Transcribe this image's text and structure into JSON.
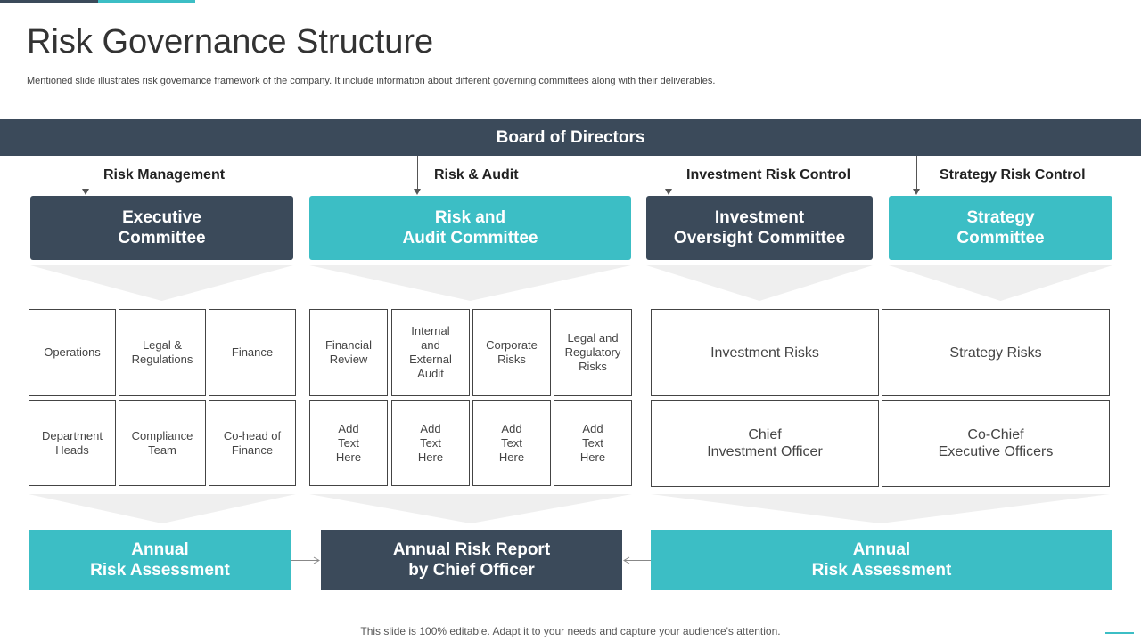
{
  "title": "Risk Governance Structure",
  "subtitle": "Mentioned slide illustrates risk governance framework of the company. It include information about different governing committees along with their deliverables.",
  "board": "Board of Directors",
  "branches": [
    "Risk Management",
    "Risk & Audit",
    "Investment Risk Control",
    "Strategy Risk Control"
  ],
  "committees": [
    "Executive\nCommittee",
    "Risk and\nAudit Committee",
    "Investment\nOversight Committee",
    "Strategy\nCommittee"
  ],
  "group1": {
    "row1": [
      "Operations",
      "Legal &\nRegulations",
      "Finance"
    ],
    "row2": [
      "Department\nHeads",
      "Compliance\nTeam",
      "Co-head of\nFinance"
    ]
  },
  "group2": {
    "row1": [
      "Financial\nReview",
      "Internal\nand\nExternal\nAudit",
      "Corporate\nRisks",
      "Legal and\nRegulatory\nRisks"
    ],
    "row2": [
      "Add\nText\nHere",
      "Add\nText\nHere",
      "Add\nText\nHere",
      "Add\nText\nHere"
    ]
  },
  "group3": {
    "row1": "Investment  Risks",
    "row2": "Chief\nInvestment  Officer"
  },
  "group4": {
    "row1": "Strategy Risks",
    "row2": "Co-Chief\nExecutive Officers"
  },
  "bottom": [
    "Annual\nRisk Assessment",
    "Annual Risk Report\nby Chief Officer",
    "Annual\nRisk Assessment"
  ],
  "footer": "This slide is 100% editable. Adapt it to your needs and capture your audience's attention.",
  "colors": {
    "dark": "#3b4a5a",
    "teal": "#3cbec5",
    "funnel": "#efefef"
  }
}
